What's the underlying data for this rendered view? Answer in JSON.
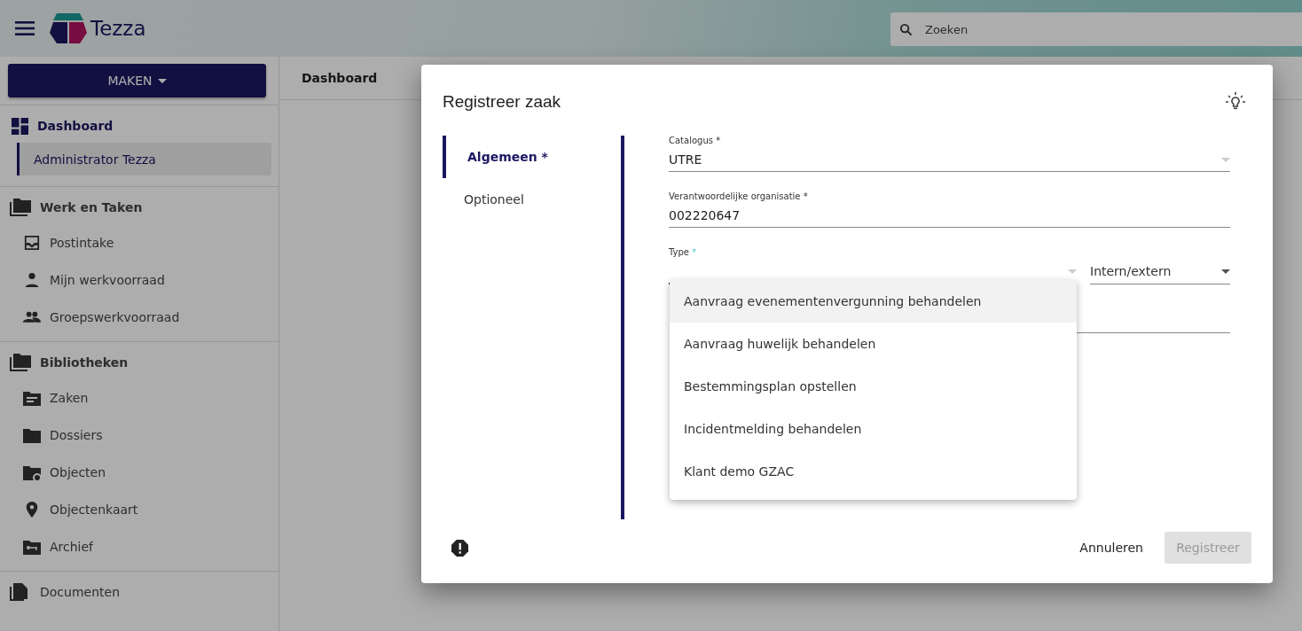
{
  "header": {
    "app_name": "Tezza",
    "search": {
      "placeholder": "Zoeken"
    }
  },
  "sidebar": {
    "create_button": "MAKEN",
    "sections": [
      {
        "label": "Dashboard",
        "items": [
          {
            "label": "Administrator Tezza",
            "selected": true
          }
        ]
      },
      {
        "label": "Werk en Taken",
        "items": [
          {
            "label": "Postintake",
            "selected": false
          },
          {
            "label": "Mijn werkvoorraad",
            "selected": false
          },
          {
            "label": "Groepswerkvoorraad",
            "selected": false
          }
        ]
      },
      {
        "label": "Bibliotheken",
        "items": [
          {
            "label": "Zaken",
            "selected": false
          },
          {
            "label": "Dossiers",
            "selected": false
          },
          {
            "label": "Objecten",
            "selected": false
          },
          {
            "label": "Objectenkaart",
            "selected": false
          },
          {
            "label": "Archief",
            "selected": false
          }
        ]
      },
      {
        "label": "Documenten"
      }
    ]
  },
  "breadcrumb": "Dashboard",
  "dialog": {
    "title": "Registreer zaak",
    "steps": [
      {
        "label": "Algemeen *",
        "selected": true
      },
      {
        "label": "Optioneel",
        "selected": false
      }
    ],
    "catalogus": {
      "label": "Catalogus *",
      "value": "UTRE"
    },
    "organisatie": {
      "label": "Verantwoordelijke organisatie *",
      "value": "002220647"
    },
    "type": {
      "label": "Type",
      "required_mark": "*",
      "options": [
        {
          "label": "Aanvraag evenementenvergunning behandelen",
          "selected": true
        },
        {
          "label": "Aanvraag huwelijk behandelen",
          "selected": false
        },
        {
          "label": "Bestemmingsplan opstellen",
          "selected": false
        },
        {
          "label": "Incidentmelding behandelen",
          "selected": false
        },
        {
          "label": "Klant demo GZAC",
          "selected": false
        }
      ]
    },
    "intern_extern": {
      "placeholder": "Intern/extern"
    },
    "cancel_button": "Annuleren",
    "register_button": {
      "label": "Registreer",
      "disabled": true
    }
  }
}
